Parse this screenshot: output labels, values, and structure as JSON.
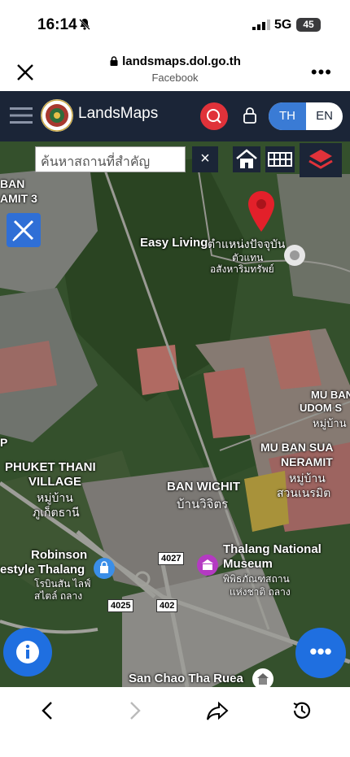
{
  "status": {
    "time": "16:14",
    "network": "5G",
    "battery": "45"
  },
  "browser": {
    "url": "landsmaps.dol.go.th",
    "source": "Facebook",
    "more": "•••"
  },
  "app": {
    "brand": "LandsMaps",
    "lang_th": "TH",
    "lang_en": "EN"
  },
  "search": {
    "placeholder": "ค้นหาสถานที่สำคัญ",
    "clear": "×"
  },
  "map_labels": {
    "easy_living": "Easy Living",
    "easy_living_th": "ตำแหน่งปัจจุบัน",
    "area_th_1": "ตัวแทน",
    "area_th_2": "อสังหาริมทรัพย์",
    "muban_namit": "BAN",
    "muban_namit2": "AMIT 3",
    "mu_ban_udom": "MU BAN",
    "mu_ban_udom2": "UDOM S",
    "mu_ban_udom_th": "หมู่บ้าน",
    "mu_ban_sua": "MU BAN SUA",
    "neramit": "NERAMIT",
    "neramit_th1": "หมู่บ้าน",
    "neramit_th2": "สวนเนรมิต",
    "phuket_thani": "PHUKET THANI",
    "village": "VILLAGE",
    "village_th1": "หมู่บ้าน",
    "village_th2": "ภูเก็ตธานี",
    "ban_wichit": "BAN WICHIT",
    "ban_wichit_th": "บ้านวิจิตร",
    "thalang_museum": "Thalang National",
    "museum": "Museum",
    "museum_th1": "พิพิธภัณฑสถาน",
    "museum_th2": "แห่งชาติ ถลาง",
    "robinson": "Robinson",
    "lifestyle": "estyle Thalang",
    "robinson_th1": "โรบินสัน ไลฟ์",
    "robinson_th2": "สไตล์ ถลาง",
    "san_chao": "San Chao Tha Ruea",
    "road_4027": "4027",
    "road_4025": "4025",
    "road_402": "402",
    "side_letter": "P"
  },
  "colors": {
    "appbar": "#1b2537",
    "accent_red": "#e0323a",
    "accent_blue": "#1f6fe0",
    "pin": "#e3202a"
  }
}
